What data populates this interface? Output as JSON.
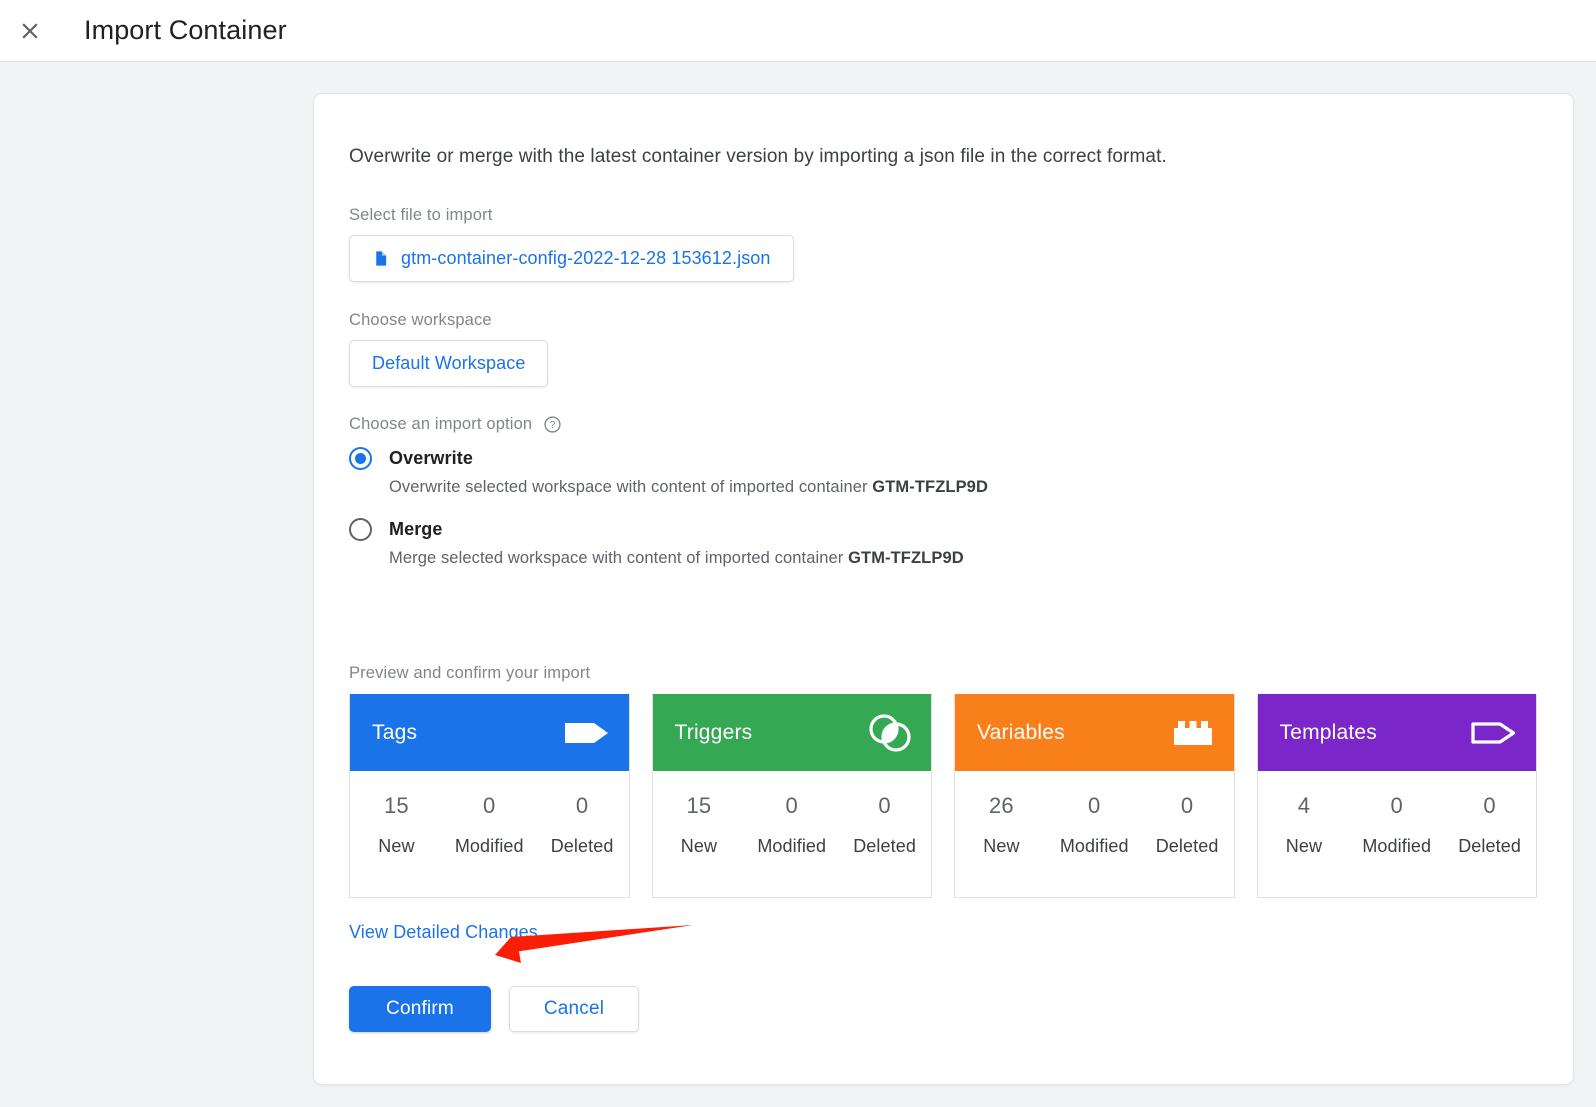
{
  "header": {
    "close_icon": "close-icon",
    "title": "Import Container"
  },
  "main": {
    "intro": "Overwrite or merge with the latest container version by importing a json file in the correct format.",
    "file_section": {
      "label": "Select file to import",
      "file_icon": "file-icon",
      "file_name": "gtm-container-config-2022-12-28 153612.json"
    },
    "workspace_section": {
      "label": "Choose workspace",
      "workspace_name": "Default Workspace"
    },
    "import_option": {
      "label": "Choose an import option",
      "help_icon": "help-circle-icon",
      "options": [
        {
          "value": "overwrite",
          "label": "Overwrite",
          "description_prefix": "Overwrite selected workspace with content of imported container ",
          "container_id": "GTM-TFZLP9D",
          "selected": true
        },
        {
          "value": "merge",
          "label": "Merge",
          "description_prefix": "Merge selected workspace with content of imported container ",
          "container_id": "GTM-TFZLP9D",
          "selected": false
        }
      ]
    },
    "preview": {
      "label": "Preview and confirm your import",
      "column_headers": [
        "New",
        "Modified",
        "Deleted"
      ],
      "cards": [
        {
          "title": "Tags",
          "color": "#1a73e8",
          "icon": "tag-filled-icon",
          "new": "15",
          "modified": "0",
          "deleted": "0"
        },
        {
          "title": "Triggers",
          "color": "#34a853",
          "icon": "overlapping-circles-icon",
          "new": "15",
          "modified": "0",
          "deleted": "0"
        },
        {
          "title": "Variables",
          "color": "#f97f1b",
          "icon": "brick-icon",
          "new": "26",
          "modified": "0",
          "deleted": "0"
        },
        {
          "title": "Templates",
          "color": "#7b26c9",
          "icon": "tag-outline-icon",
          "new": "4",
          "modified": "0",
          "deleted": "0"
        }
      ]
    },
    "view_detailed_changes": "View Detailed Changes",
    "actions": {
      "confirm": "Confirm",
      "cancel": "Cancel"
    }
  },
  "annotation": {
    "arrow_color": "#fb1e06"
  }
}
